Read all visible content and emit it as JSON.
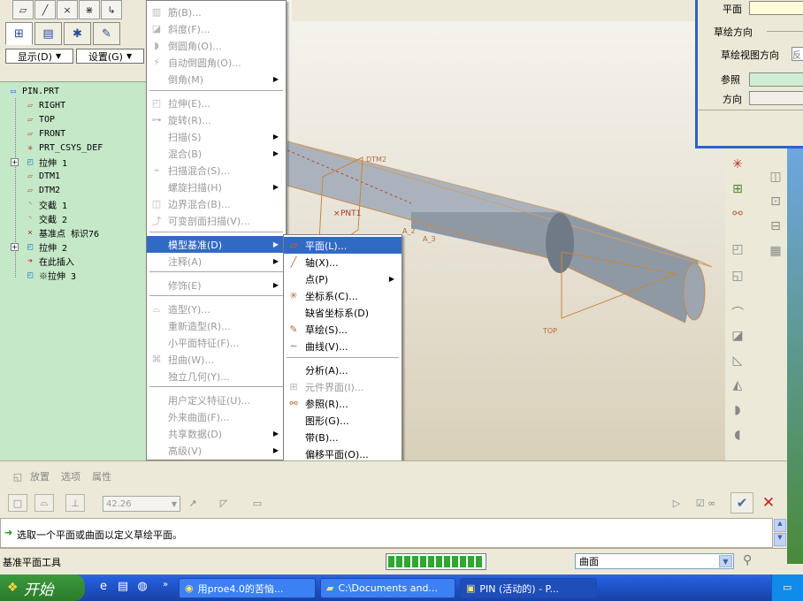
{
  "left_panel": {
    "tabs": [
      "tree-tab",
      "layers-tab",
      "favorites-tab",
      "browser-tab"
    ],
    "show_combo": "显示(D)",
    "settings_combo": "设置(G)",
    "tree_items": [
      {
        "label": "PIN.PRT",
        "icon": "part-icon"
      },
      {
        "label": "RIGHT",
        "icon": "datum-plane-icon"
      },
      {
        "label": "TOP",
        "icon": "datum-plane-icon"
      },
      {
        "label": "FRONT",
        "icon": "datum-plane-icon"
      },
      {
        "label": "PRT_CSYS_DEF",
        "icon": "csys-icon"
      },
      {
        "label": "拉伸 1",
        "icon": "extrude-icon"
      },
      {
        "label": "DTM1",
        "icon": "datum-plane-icon"
      },
      {
        "label": "DTM2",
        "icon": "datum-plane-icon"
      },
      {
        "label": "交截 1",
        "icon": "intersect-icon"
      },
      {
        "label": "交截 2",
        "icon": "intersect-icon"
      },
      {
        "label": "基准点 标识76",
        "icon": "datum-point-icon"
      },
      {
        "label": "拉伸 2",
        "icon": "extrude-icon"
      },
      {
        "label": "在此插入",
        "icon": "insert-here-arrow-icon"
      },
      {
        "label": "※拉伸 3",
        "icon": "extrude-icon"
      }
    ]
  },
  "insert_menu": {
    "items": [
      {
        "label": "筋(B)...",
        "icon": "rib-icon",
        "disabled": true,
        "submenu": false
      },
      {
        "label": "斜度(F)...",
        "icon": "draft-icon",
        "disabled": true,
        "submenu": false
      },
      {
        "label": "倒圆角(O)...",
        "icon": "round-icon",
        "disabled": true,
        "submenu": false
      },
      {
        "label": "自动倒圆角(O)...",
        "icon": "auto-round-icon",
        "disabled": true,
        "submenu": false
      },
      {
        "label": "倒角(M)",
        "icon": "",
        "disabled": true,
        "submenu": true
      },
      {
        "label": "拉伸(E)...",
        "icon": "extrude-icon",
        "disabled": true,
        "submenu": false
      },
      {
        "label": "旋转(R)...",
        "icon": "revolve-icon",
        "disabled": true,
        "submenu": false
      },
      {
        "label": "扫描(S)",
        "icon": "",
        "disabled": true,
        "submenu": true
      },
      {
        "label": "混合(B)",
        "icon": "",
        "disabled": true,
        "submenu": true
      },
      {
        "label": "扫描混合(S)...",
        "icon": "swept-blend-icon",
        "disabled": true,
        "submenu": false
      },
      {
        "label": "螺旋扫描(H)",
        "icon": "",
        "disabled": true,
        "submenu": true
      },
      {
        "label": "边界混合(B)...",
        "icon": "boundary-blend-icon",
        "disabled": true,
        "submenu": false
      },
      {
        "label": "可变剖面扫描(V)...",
        "icon": "var-sweep-icon",
        "disabled": true,
        "submenu": false
      },
      {
        "label": "模型基准(D)",
        "icon": "",
        "disabled": false,
        "submenu": true,
        "highlight": true
      },
      {
        "label": "注释(A)",
        "icon": "",
        "disabled": true,
        "submenu": true
      },
      {
        "label": "修饰(E)",
        "icon": "",
        "disabled": true,
        "submenu": true
      },
      {
        "label": "造型(Y)...",
        "icon": "style-icon",
        "disabled": true,
        "submenu": false
      },
      {
        "label": "重新造型(R)...",
        "icon": "",
        "disabled": true,
        "submenu": false
      },
      {
        "label": "小平面特征(F)...",
        "icon": "",
        "disabled": true,
        "submenu": false
      },
      {
        "label": "扭曲(W)...",
        "icon": "warp-icon",
        "disabled": true,
        "submenu": false
      },
      {
        "label": "独立几何(Y)...",
        "icon": "",
        "disabled": true,
        "submenu": false
      },
      {
        "label": "用户定义特征(U)...",
        "icon": "",
        "disabled": true,
        "submenu": false
      },
      {
        "label": "外来曲面(F)...",
        "icon": "",
        "disabled": true,
        "submenu": false
      },
      {
        "label": "共享数据(D)",
        "icon": "",
        "disabled": true,
        "submenu": true
      },
      {
        "label": "高级(V)",
        "icon": "",
        "disabled": true,
        "submenu": true
      }
    ]
  },
  "datum_menu": {
    "items": [
      {
        "label": "平面(L)...",
        "icon": "plane-icon",
        "disabled": false,
        "submenu": false,
        "highlight": true
      },
      {
        "label": "轴(X)...",
        "icon": "axis-icon",
        "disabled": false,
        "submenu": false
      },
      {
        "label": "点(P)",
        "icon": "",
        "disabled": false,
        "submenu": true
      },
      {
        "label": "坐标系(C)...",
        "icon": "csys-icon",
        "disabled": false,
        "submenu": false
      },
      {
        "label": "缺省坐标系(D)",
        "icon": "",
        "disabled": false,
        "submenu": false
      },
      {
        "label": "草绘(S)...",
        "icon": "sketch-icon",
        "disabled": false,
        "submenu": false
      },
      {
        "label": "曲线(V)...",
        "icon": "curve-icon",
        "disabled": false,
        "submenu": false
      },
      {
        "label": "分析(A)...",
        "icon": "",
        "disabled": false,
        "submenu": false
      },
      {
        "label": "元件界面(I)...",
        "icon": "interface-icon",
        "disabled": true,
        "submenu": false
      },
      {
        "label": "参照(R)...",
        "icon": "reference-icon",
        "disabled": false,
        "submenu": false
      },
      {
        "label": "图形(G)...",
        "icon": "",
        "disabled": false,
        "submenu": false
      },
      {
        "label": "带(B)...",
        "icon": "",
        "disabled": false,
        "submenu": false
      },
      {
        "label": "偏移平面(O)...",
        "icon": "",
        "disabled": false,
        "submenu": false
      }
    ]
  },
  "viewport": {
    "labels": {
      "dtm2": "DTM2",
      "pnt1": "PNT1",
      "a2": "A_2",
      "a3": "A_3",
      "top": "TOP"
    }
  },
  "dialog": {
    "plane_label": "平面",
    "sketch_direction_label": "草绘方向",
    "sketch_view_direction_label": "草绘视图方向",
    "sketch_view_direction_value": "反",
    "reference_label": "参照",
    "direction_label": "方向"
  },
  "dashboard": {
    "tabs": [
      "放置",
      "选项",
      "属性"
    ],
    "value": "42.26"
  },
  "message": "选取一个平面或曲面以定义草绘平面。",
  "status": {
    "tool_name": "基准平面工具",
    "filter": "曲面",
    "progress_percent": 100
  },
  "taskbar": {
    "start_label": "开始",
    "tasks": [
      {
        "label": "用proe4.0的苦恼...",
        "active": false
      },
      {
        "label": "C:\\Documents and...",
        "active": false
      },
      {
        "label": "PIN (活动的) - P...",
        "active": true
      }
    ]
  },
  "colors": {
    "highlight": "#316ac5",
    "tree_bg": "#c5e8c8",
    "taskbar": "#245edb"
  }
}
